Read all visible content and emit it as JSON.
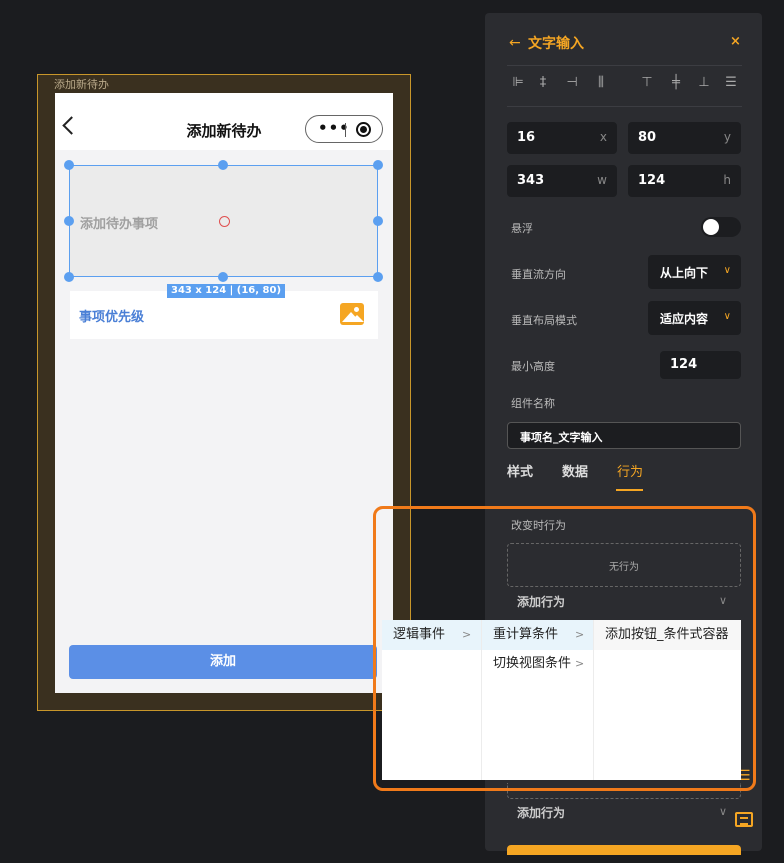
{
  "canvas": {
    "frame_title": "添加新待办",
    "phone": {
      "title": "添加新待办",
      "capsule_dots": "•••",
      "text_input_placeholder": "添加待办事项",
      "size_badge": "343 x 124 | (16, 80)",
      "priority_label": "事项优先级",
      "add_button": "添加"
    }
  },
  "panel": {
    "back_icon": "←",
    "title": "文字输入",
    "close_icon": "×",
    "align_icons": [
      "align-left-icon",
      "align-center-h-icon",
      "align-right-icon",
      "distribute-h-icon",
      "align-top-icon",
      "align-center-v-icon",
      "align-bottom-icon",
      "distribute-v-icon"
    ],
    "align_glyphs": [
      "⊫",
      "‡",
      "⊣",
      "⫼",
      "⊤",
      "╪",
      "⊥",
      "☰"
    ],
    "x": {
      "value": "16",
      "unit": "x"
    },
    "y": {
      "value": "80",
      "unit": "y"
    },
    "w": {
      "value": "343",
      "unit": "w"
    },
    "h": {
      "value": "124",
      "unit": "h"
    },
    "float_label": "悬浮",
    "float_on": false,
    "flow_direction_label": "垂直流方向",
    "flow_direction_value": "从上向下",
    "layout_mode_label": "垂直布局模式",
    "layout_mode_value": "适应内容",
    "min_height_label": "最小高度",
    "min_height_value": "124",
    "component_name_label": "组件名称",
    "component_name_value": "事项名_文字输入",
    "tabs": [
      "样式",
      "数据",
      "行为"
    ],
    "active_tab": "行为",
    "change_behavior_label": "改变时行为",
    "no_behavior": "无行为",
    "add_behavior": "添加行为",
    "chevron_down": "∨",
    "chevron_right": ">"
  },
  "cascade_menu": {
    "col1": [
      {
        "label": "逻辑事件",
        "has_arrow": true
      }
    ],
    "col2": [
      {
        "label": "重计算条件",
        "has_arrow": true
      },
      {
        "label": "切换视图条件",
        "has_arrow": true
      }
    ],
    "col3": [
      {
        "label": "添加按钮_条件式容器",
        "has_arrow": false
      }
    ]
  },
  "colors": {
    "accent": "#f5a623",
    "selection": "#5b9ff0",
    "callout": "#f07a1a",
    "primary_button": "#5b8fe6"
  }
}
